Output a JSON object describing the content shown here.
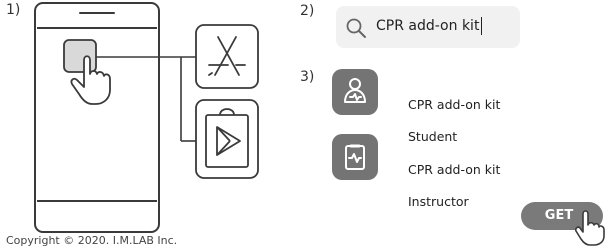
{
  "steps": {
    "one": "1)",
    "two": "2)",
    "three": "3)"
  },
  "stores": {
    "app_store_icon": "app-store-icon",
    "play_store_icon": "play-store-icon"
  },
  "search": {
    "query": "CPR add-on kit",
    "icon": "search-icon"
  },
  "apps": [
    {
      "name": "CPR add-on kit",
      "variant": "Student",
      "icon": "student-app-icon"
    },
    {
      "name": "CPR add-on kit",
      "variant": "Instructor",
      "icon": "instructor-app-icon"
    }
  ],
  "get_button": {
    "label": "GET"
  },
  "footer": {
    "copyright": "Copyright © 2020. I.M.LAB Inc."
  },
  "colors": {
    "app_tile": "#747474",
    "button": "#7a7a7a",
    "search_bg": "#f1f1f1",
    "stroke": "#3a3a3a"
  }
}
